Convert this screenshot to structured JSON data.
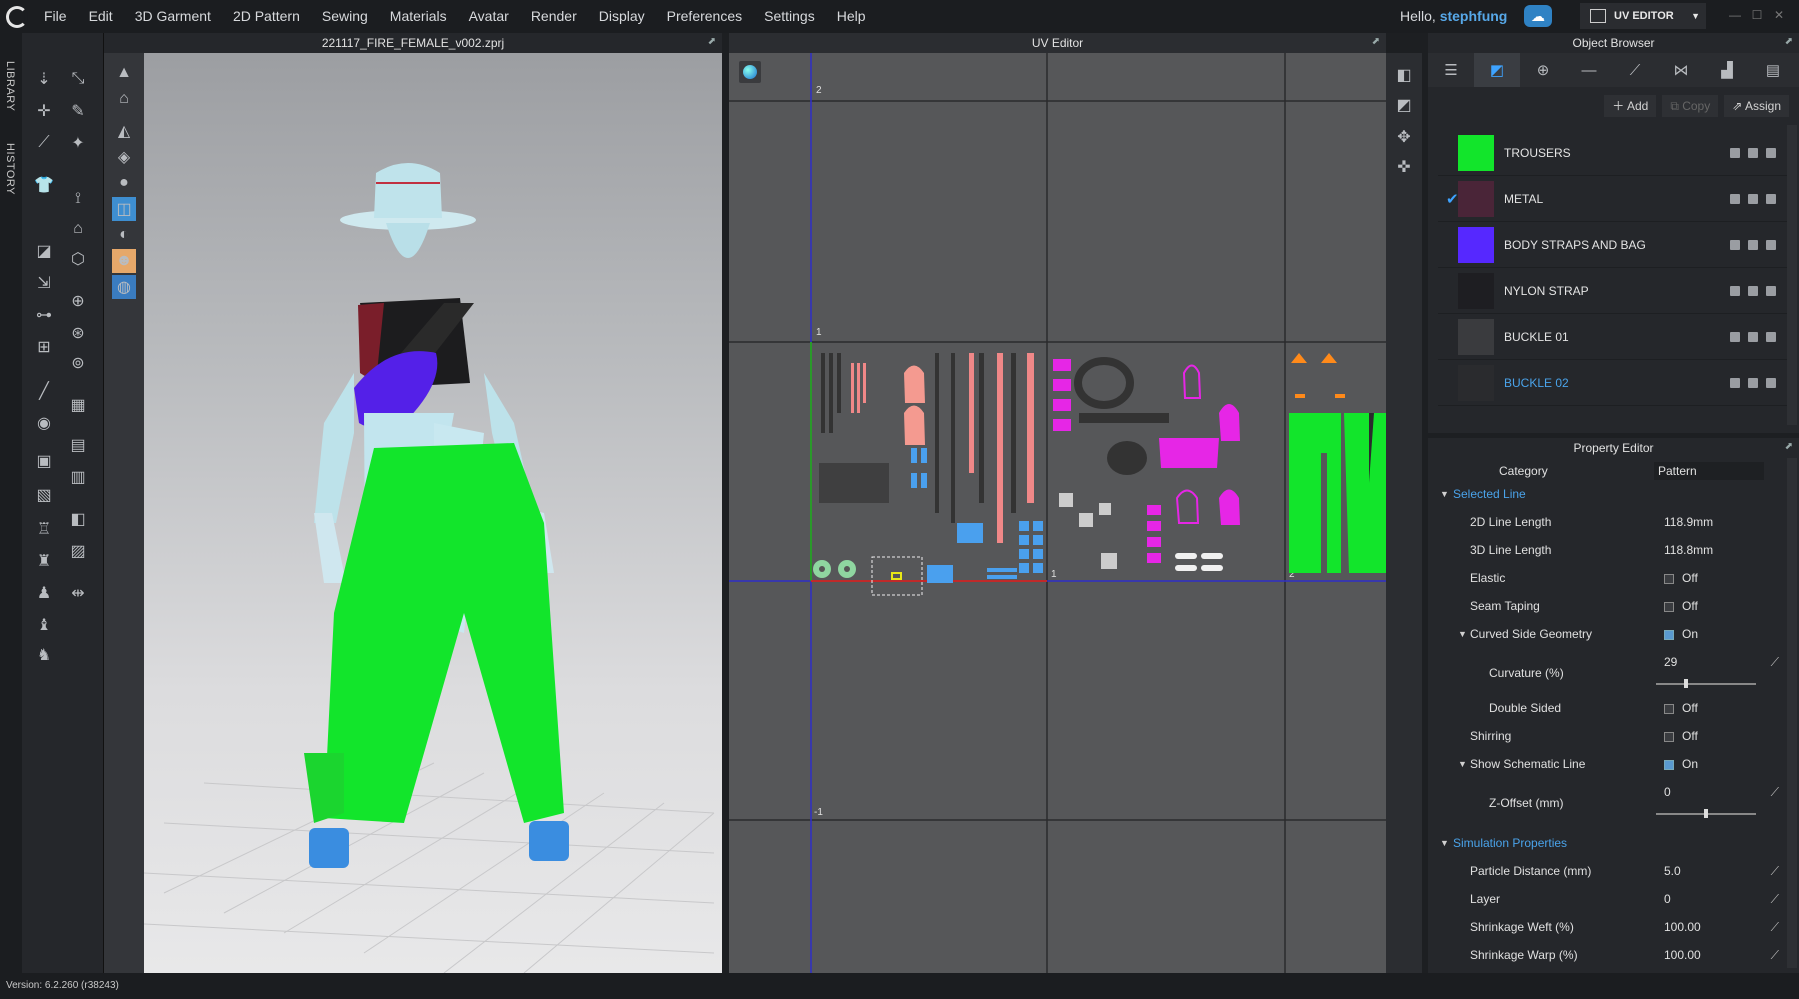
{
  "menubar": {
    "items": [
      "File",
      "Edit",
      "3D Garment",
      "2D Pattern",
      "Sewing",
      "Materials",
      "Avatar",
      "Render",
      "Display",
      "Preferences",
      "Settings",
      "Help"
    ],
    "greeting_prefix": "Hello,",
    "username": "stephfung",
    "mode_label": "UV EDITOR"
  },
  "left_tabs": [
    "LIBRARY",
    "HISTORY"
  ],
  "viewport3d": {
    "title": "221117_FIRE_FEMALE_v002.zprj"
  },
  "uv_editor": {
    "title": "UV Editor",
    "grid_labels": [
      "2",
      "1",
      "-1",
      "1",
      "2"
    ]
  },
  "object_browser": {
    "title": "Object Browser",
    "actions": {
      "add": "Add",
      "copy": "Copy",
      "assign": "Assign"
    },
    "materials": [
      {
        "name": "TROUSERS",
        "color": "#12e52b",
        "selected": false
      },
      {
        "name": "METAL",
        "color": "#4a2538",
        "selected": false,
        "checked": true
      },
      {
        "name": "BODY STRAPS AND BAG",
        "color": "#5628ff",
        "selected": false
      },
      {
        "name": "NYLON STRAP",
        "color": "#1e1e22",
        "selected": false
      },
      {
        "name": "BUCKLE 01",
        "color": "#3a3b3e",
        "selected": false
      },
      {
        "name": "BUCKLE 02",
        "color": "#2a2b2e",
        "selected": true
      }
    ]
  },
  "property_editor": {
    "title": "Property Editor",
    "category": {
      "label": "Category",
      "value": "Pattern"
    },
    "selected_line": "Selected Line",
    "line_2d": {
      "label": "2D Line Length",
      "value": "118.9mm"
    },
    "line_3d": {
      "label": "3D Line Length",
      "value": "118.8mm"
    },
    "elastic": {
      "label": "Elastic",
      "value": "Off"
    },
    "seam_taping": {
      "label": "Seam Taping",
      "value": "Off"
    },
    "curved": {
      "label": "Curved Side Geometry",
      "value": "On"
    },
    "curvature": {
      "label": "Curvature (%)",
      "value": "29",
      "level": 0.29
    },
    "double_sided": {
      "label": "Double Sided",
      "value": "Off"
    },
    "shirring": {
      "label": "Shirring",
      "value": "Off"
    },
    "schematic": {
      "label": "Show Schematic Line",
      "value": "On"
    },
    "zoffset": {
      "label": "Z-Offset (mm)",
      "value": "0",
      "level": 0.5
    },
    "sim_props": "Simulation Properties",
    "particle": {
      "label": "Particle Distance (mm)",
      "value": "5.0"
    },
    "layer": {
      "label": "Layer",
      "value": "0"
    },
    "weft": {
      "label": "Shrinkage Weft (%)",
      "value": "100.00"
    },
    "warp": {
      "label": "Shrinkage Warp (%)",
      "value": "100.00"
    }
  },
  "status": {
    "version": "Version: 6.2.260 (r38243)"
  }
}
